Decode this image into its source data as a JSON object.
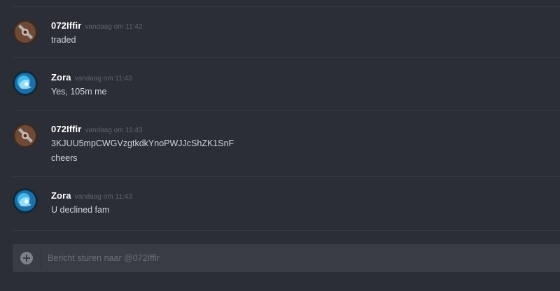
{
  "input": {
    "placeholder": "Bericht sturen naar @072Iffir"
  },
  "messages": [
    {
      "author": "072Iffir",
      "timestamp": "vandaag om 11:42",
      "avatar_icon": "armored-warrior-avatar-icon",
      "lines": [
        "traded"
      ]
    },
    {
      "author": "Zora",
      "timestamp": "vandaag om 11:43",
      "avatar_icon": "blue-glowing-orb-avatar-icon",
      "lines": [
        "Yes, 105m me"
      ]
    },
    {
      "author": "072Iffir",
      "timestamp": "vandaag om 11:43",
      "avatar_icon": "armored-warrior-avatar-icon",
      "lines": [
        "3KJUU5mpCWGVzgtkdkYnoPWJJcShZK1SnF",
        "cheers"
      ]
    },
    {
      "author": "Zora",
      "timestamp": "vandaag om 11:43",
      "avatar_icon": "blue-glowing-orb-avatar-icon",
      "lines": [
        "U declined fam"
      ]
    }
  ],
  "colors": {
    "background": "#2b2e36",
    "input_background": "#393c45",
    "username": "#ffffff",
    "timestamp": "#5f636b",
    "message_text": "#d0d3d8"
  }
}
